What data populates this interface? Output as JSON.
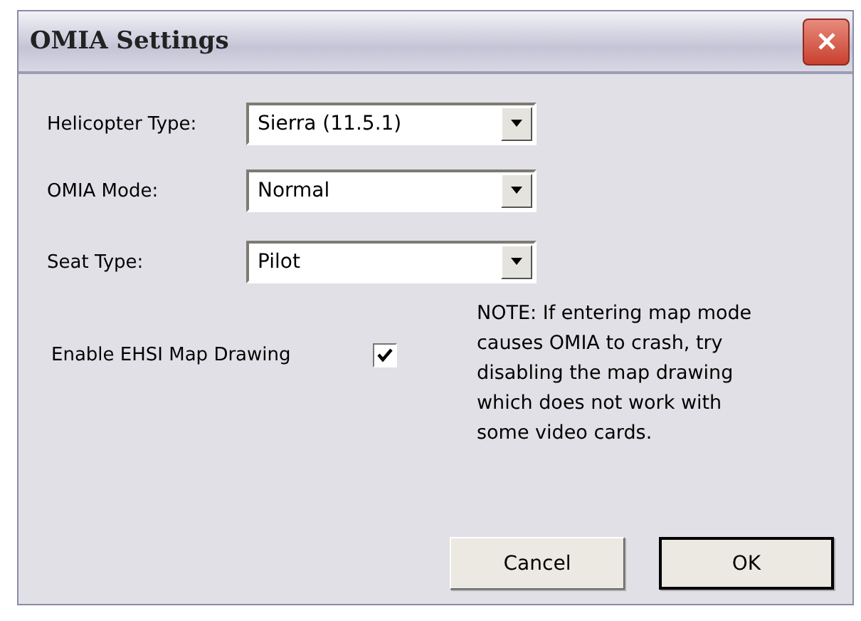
{
  "window": {
    "title": "OMIA Settings"
  },
  "fields": [
    {
      "label": "Helicopter Type:",
      "value": "Sierra (11.5.1)"
    },
    {
      "label": "OMIA Mode:",
      "value": "Normal"
    },
    {
      "label": "Seat Type:",
      "value": "Pilot"
    }
  ],
  "map_drawing": {
    "label": "Enable EHSI Map Drawing",
    "checked": true
  },
  "note": "NOTE: If entering map mode causes OMIA to crash, try disabling the map drawing which does not work with some video cards.",
  "buttons": [
    {
      "label": "Cancel",
      "default": false
    },
    {
      "label": "OK",
      "default": true
    }
  ]
}
